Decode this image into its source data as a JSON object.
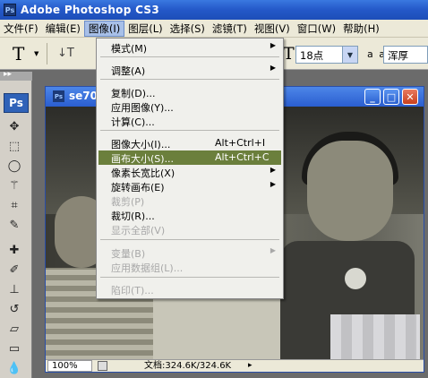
{
  "app": {
    "title": "Adobe Photoshop CS3",
    "logo": "Ps"
  },
  "menubar": [
    {
      "label": "文件(F)"
    },
    {
      "label": "编辑(E)"
    },
    {
      "label": "图像(I)",
      "active": true
    },
    {
      "label": "图层(L)"
    },
    {
      "label": "选择(S)"
    },
    {
      "label": "滤镜(T)"
    },
    {
      "label": "视图(V)"
    },
    {
      "label": "窗口(W)"
    },
    {
      "label": "帮助(H)"
    }
  ],
  "options": {
    "tool_glyph": "T",
    "font_size": "18点",
    "aa_label": "a a",
    "aa_value": "浑厚"
  },
  "toolbox": {
    "badge": "Ps"
  },
  "document": {
    "title": "se70",
    "zoom": "100%",
    "doc_size": "文档:324.6K/324.6K"
  },
  "image_menu": {
    "items": [
      {
        "label": "模式(M)",
        "submenu": true
      },
      {
        "label": "调整(A)",
        "submenu": true
      },
      {
        "label": "复制(D)..."
      },
      {
        "label": "应用图像(Y)..."
      },
      {
        "label": "计算(C)..."
      },
      {
        "label": "图像大小(I)...",
        "shortcut": "Alt+Ctrl+I"
      },
      {
        "label": "画布大小(S)...",
        "shortcut": "Alt+Ctrl+C",
        "highlighted": true
      },
      {
        "label": "像素长宽比(X)",
        "submenu": true
      },
      {
        "label": "旋转画布(E)",
        "submenu": true
      },
      {
        "label": "裁剪(P)",
        "disabled": true
      },
      {
        "label": "裁切(R)..."
      },
      {
        "label": "显示全部(V)",
        "disabled": true
      },
      {
        "label": "变量(B)",
        "submenu": true,
        "disabled": true
      },
      {
        "label": "应用数据组(L)...",
        "disabled": true
      },
      {
        "label": "陷印(T)...",
        "disabled": true
      }
    ]
  },
  "colors": {
    "highlight": "#6b7f3c",
    "titlebar": "#2458c8",
    "chrome": "#ece9d8"
  }
}
